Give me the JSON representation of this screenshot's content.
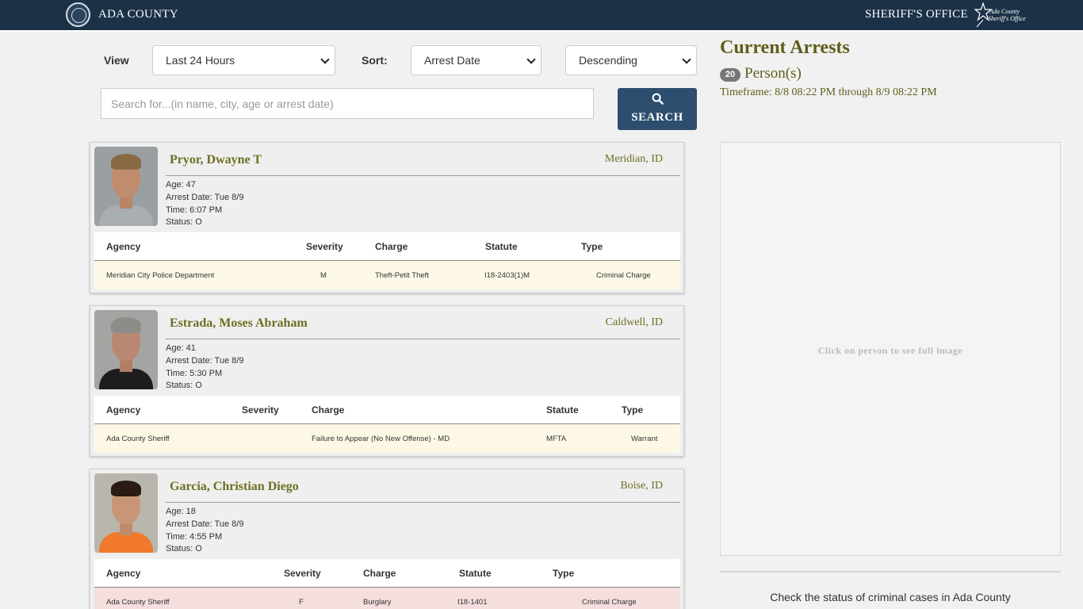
{
  "header": {
    "county_name": "ADA COUNTY",
    "office_name": "SHERIFF'S OFFICE",
    "sheriff_logo_line1": "Ada County",
    "sheriff_logo_line2": "Sheriff's Office",
    "icons": {
      "seal": "county-seal-icon",
      "badge": "sheriff-star-icon"
    }
  },
  "filters": {
    "view_label": "View",
    "view_value": "Last 24 Hours",
    "sort_label": "Sort:",
    "sort_value": "Arrest Date",
    "order_value": "Descending",
    "search_placeholder": "Search for...(in name, city, age or arrest date)",
    "search_button": "SEARCH"
  },
  "arrests": [
    {
      "name": "Pryor, Dwayne T",
      "city": "Meridian, ID",
      "age": "Age: 47",
      "arrest_date": "Arrest Date: Tue 8/9",
      "time": "Time: 6:07 PM",
      "status": "Status: O",
      "headers": [
        "Agency",
        "Severity",
        "Charge",
        "Statute",
        "Type"
      ],
      "charge": {
        "agency": "Meridian City Police Department",
        "severity": "M",
        "charge": "Theft-Petit Theft",
        "statute": "I18-2403(1)M",
        "type": "Criminal Charge"
      },
      "row_color": "#fdf8e6"
    },
    {
      "name": "Estrada, Moses Abraham",
      "city": "Caldwell, ID",
      "age": "Age: 41",
      "arrest_date": "Arrest Date: Tue 8/9",
      "time": "Time: 5:30 PM",
      "status": "Status: O",
      "headers": [
        "Agency",
        "Severity",
        "Charge",
        "Statute",
        "Type"
      ],
      "charge": {
        "agency": "Ada County Sheriff",
        "severity": "",
        "charge": "Failure to Appear (No New Offense) - MD",
        "statute": "MFTA",
        "type": "Warrant"
      },
      "row_color": "#fdf8e6"
    },
    {
      "name": "Garcia, Christian Diego",
      "city": "Boise, ID",
      "age": "Age: 18",
      "arrest_date": "Arrest Date: Tue 8/9",
      "time": "Time: 4:55 PM",
      "status": "Status: O",
      "headers": [
        "Agency",
        "Severity",
        "Charge",
        "Statute",
        "Type"
      ],
      "charge": {
        "agency": "Ada County Sheriff",
        "severity": "F",
        "charge": "Burglary",
        "statute": "I18-1401",
        "type": "Criminal Charge"
      },
      "row_color": "#f5dede"
    }
  ],
  "right_panel": {
    "title": "Current Arrests",
    "count": "20",
    "persons_label": "Person(s)",
    "timeframe": "Timeframe: 8/8 08:22 PM through 8/9 08:22 PM",
    "image_hint": "Click on person to see full image",
    "bottom_text": "Check the status of criminal cases in Ada County"
  },
  "colors": {
    "header_bg": "#1b3148",
    "accent_olive": "#6e6e22",
    "button_bg": "#2d4e6e"
  }
}
